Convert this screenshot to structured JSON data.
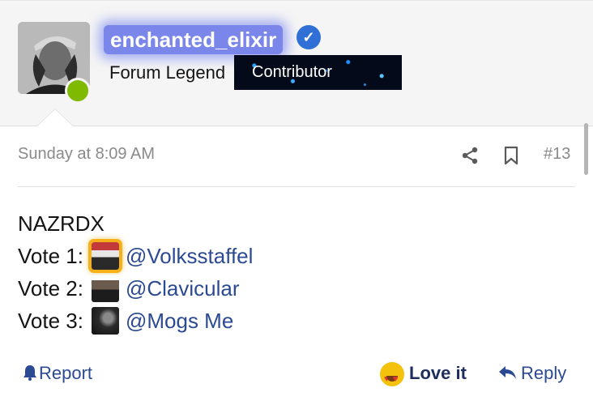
{
  "author": {
    "username": "enchanted_elixir",
    "verified_icon": "verified-check-icon",
    "user_title": "Forum Legend",
    "banner": "Contributor",
    "online_status_color": "#7fba00"
  },
  "post": {
    "date": "Sunday at 8:09 AM",
    "number": "#13",
    "share_icon": "share-icon",
    "bookmark_icon": "bookmark-icon",
    "body": {
      "heading": "NAZRDX",
      "votes": [
        {
          "label": "Vote 1:",
          "mention": "@Volksstaffel"
        },
        {
          "label": "Vote 2:",
          "mention": "@Clavicular"
        },
        {
          "label": "Vote 3:",
          "mention": "@Mogs Me"
        }
      ]
    }
  },
  "actions": {
    "report": "Report",
    "love": "Love it",
    "reply": "Reply"
  },
  "colors": {
    "link": "#2c4a93",
    "username_highlight": "#7b86ea",
    "verified": "#2f6fd6"
  }
}
